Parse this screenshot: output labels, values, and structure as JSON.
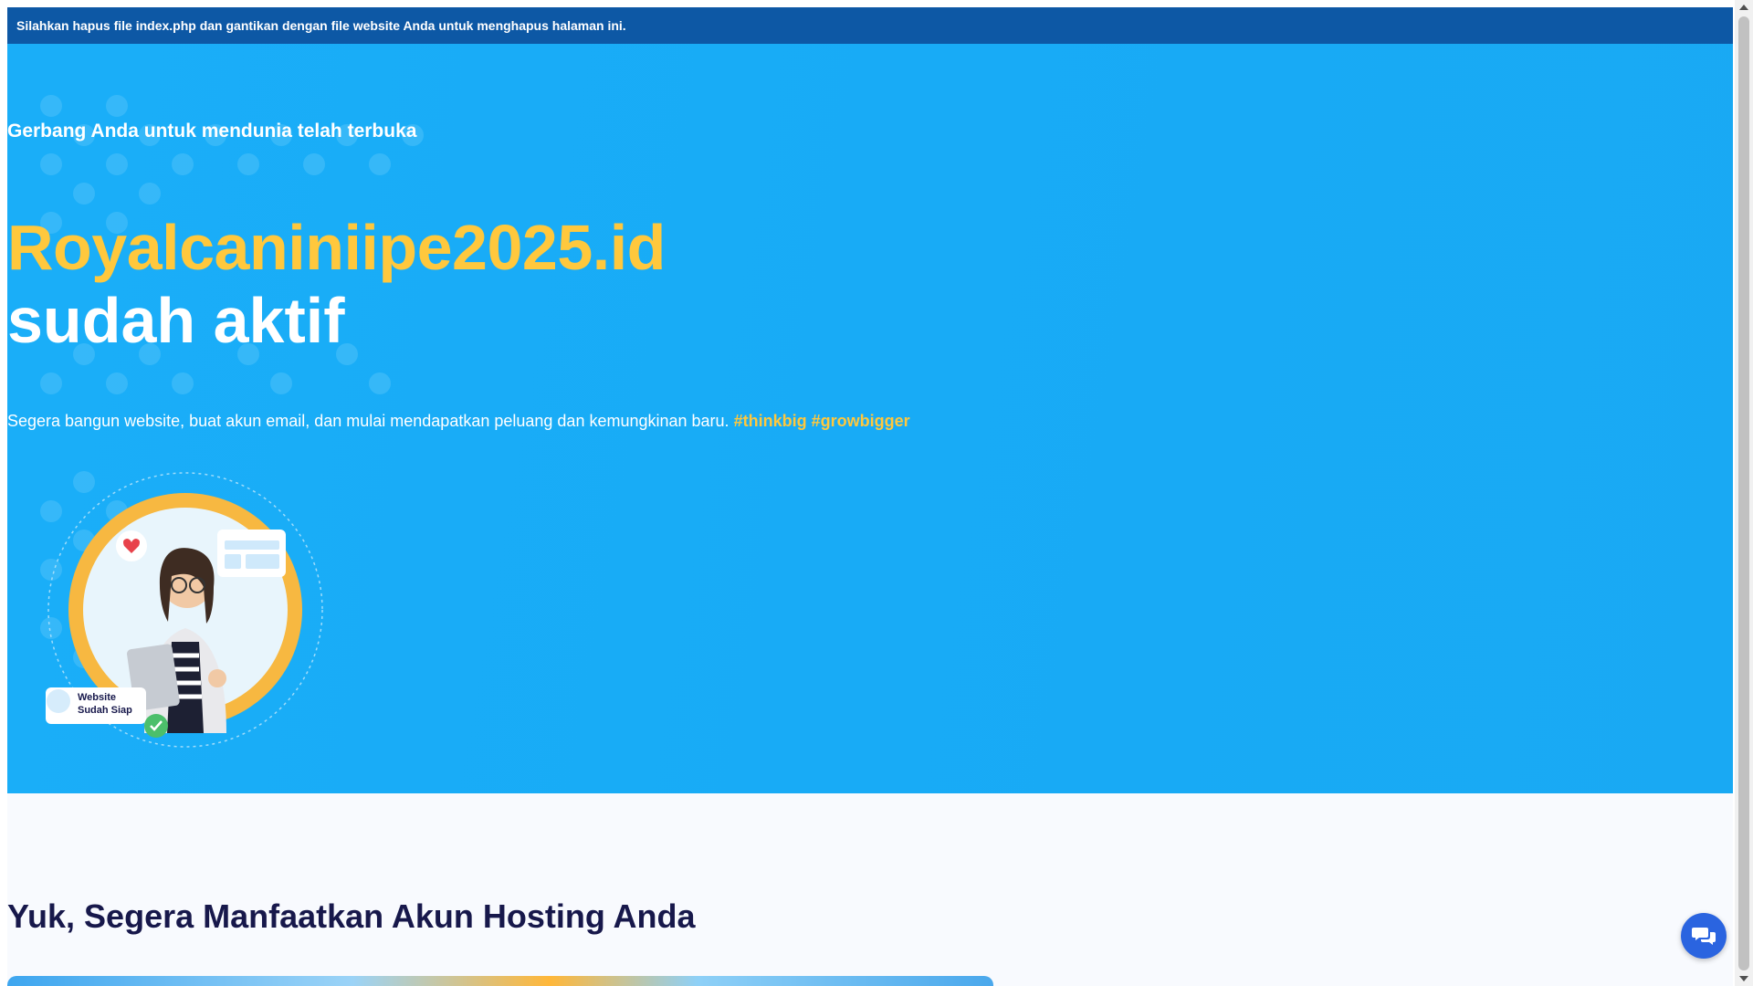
{
  "notice": {
    "text": "Silahkan hapus file index.php dan gantikan dengan file website Anda untuk menghapus halaman ini."
  },
  "hero": {
    "subtitle": "Gerbang Anda untuk mendunia telah terbuka",
    "domain": "Royalcaniniipe2025.id",
    "status": "sudah aktif",
    "description": "Segera bangun website, buat akun email, dan mulai mendapatkan peluang dan kemungkinan baru.",
    "hashtags": "#thinkbig #growbigger",
    "illustration_badge_line1": "Website",
    "illustration_badge_line2": "Sudah Siap"
  },
  "section": {
    "title": "Yuk, Segera Manfaatkan Akun Hosting Anda"
  },
  "colors": {
    "notice_bg": "#0d58a5",
    "hero_bg": "#1aaef8",
    "accent_yellow": "#ffc83d",
    "title_navy": "#17184b",
    "chat_blue": "#2a64e0"
  },
  "icons": {
    "chat": "chat-bubbles-icon",
    "heart": "heart-icon",
    "check": "check-circle-icon",
    "web": "browser-window-icon"
  }
}
